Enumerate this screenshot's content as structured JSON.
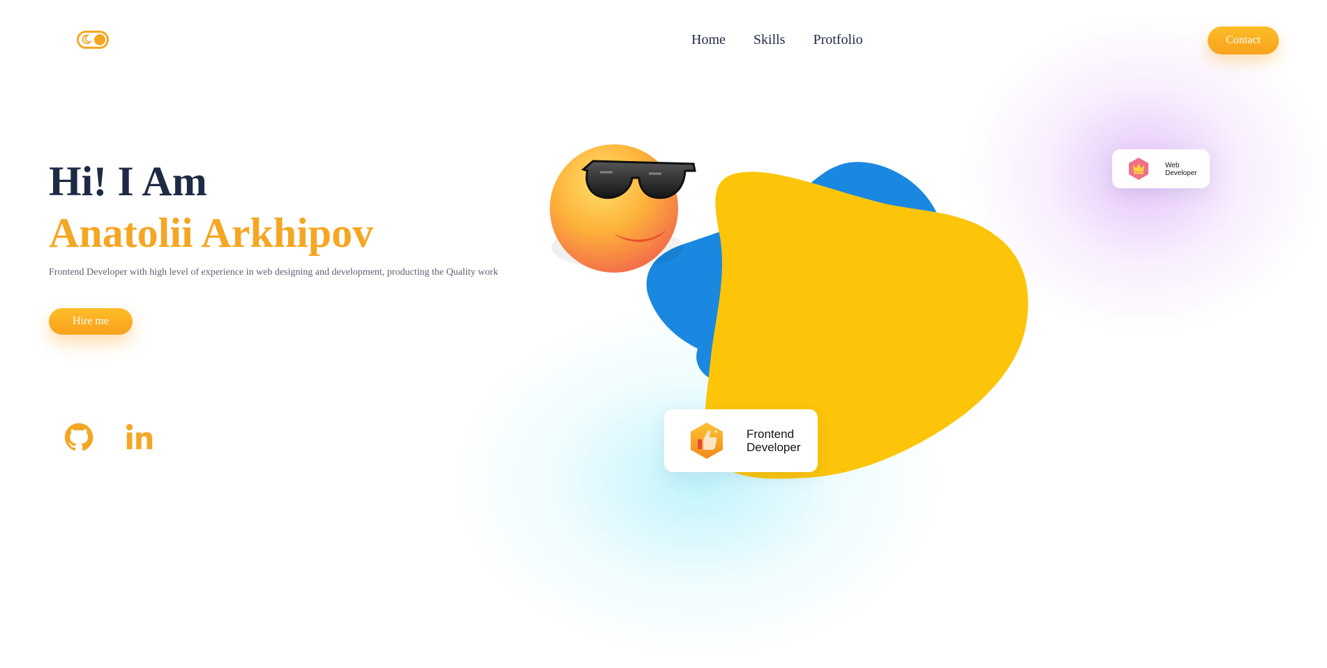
{
  "header": {
    "theme_toggle_icon": "moon-icon",
    "nav": [
      {
        "label": "Home"
      },
      {
        "label": "Skills"
      },
      {
        "label": "Protfolio"
      }
    ],
    "contact_label": "Contact"
  },
  "hero": {
    "greeting": "Hi! I Am",
    "name": "Anatolii Arkhipov",
    "description": "Frontend Developer with high level of experience in web designing and development, producting the Quality work",
    "hire_label": "Hire me"
  },
  "social": [
    {
      "icon": "github-icon"
    },
    {
      "icon": "linkedin-icon"
    }
  ],
  "illustration": {
    "emoji": "smiling-face-with-sunglasses-icon",
    "badges": [
      {
        "label": "Frontend\nDeveloper",
        "icon": "thumbs-up-icon"
      },
      {
        "label": "Web\nDeveloper",
        "icon": "crown-icon"
      }
    ]
  },
  "colors": {
    "accent": "#f5a623",
    "heading": "#1e2a44",
    "blob_yellow": "#fcc50a",
    "blob_blue": "#1a88e0"
  }
}
